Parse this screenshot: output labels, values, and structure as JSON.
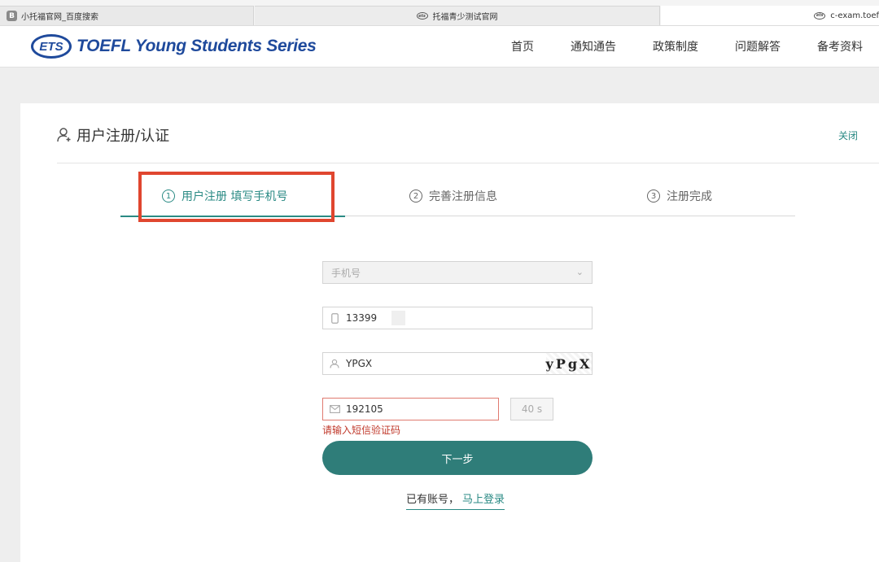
{
  "browser": {
    "tabs": [
      {
        "label": "小托福官网_百度搜索",
        "favicon": "B"
      },
      {
        "label": "托福青少测试官网"
      },
      {
        "label": "c-exam.toef"
      }
    ]
  },
  "header": {
    "logo_mark": "ETS",
    "logo_text": "TOEFL Young Students Series",
    "nav": [
      "首页",
      "通知通告",
      "政策制度",
      "问题解答",
      "备考资料"
    ]
  },
  "card": {
    "title": "用户注册/认证",
    "close": "关闭",
    "steps": [
      {
        "num": "1",
        "label": "用户注册 填写手机号",
        "active": true
      },
      {
        "num": "2",
        "label": "完善注册信息",
        "active": false
      },
      {
        "num": "3",
        "label": "注册完成",
        "active": false
      }
    ]
  },
  "form": {
    "country_placeholder": "手机号",
    "phone_value": "13399",
    "captcha_value": "YPGX",
    "captcha_image_text": "yPgX",
    "sms_value": "192105",
    "countdown": "40 s",
    "error": "请输入短信验证码",
    "next": "下一步",
    "has_account": "已有账号，",
    "login": "马上登录"
  },
  "colors": {
    "accent": "#2a8a84",
    "button": "#2f7d79",
    "error": "#c0392b",
    "highlight": "#e0462f",
    "brand": "#1f4a9c"
  }
}
